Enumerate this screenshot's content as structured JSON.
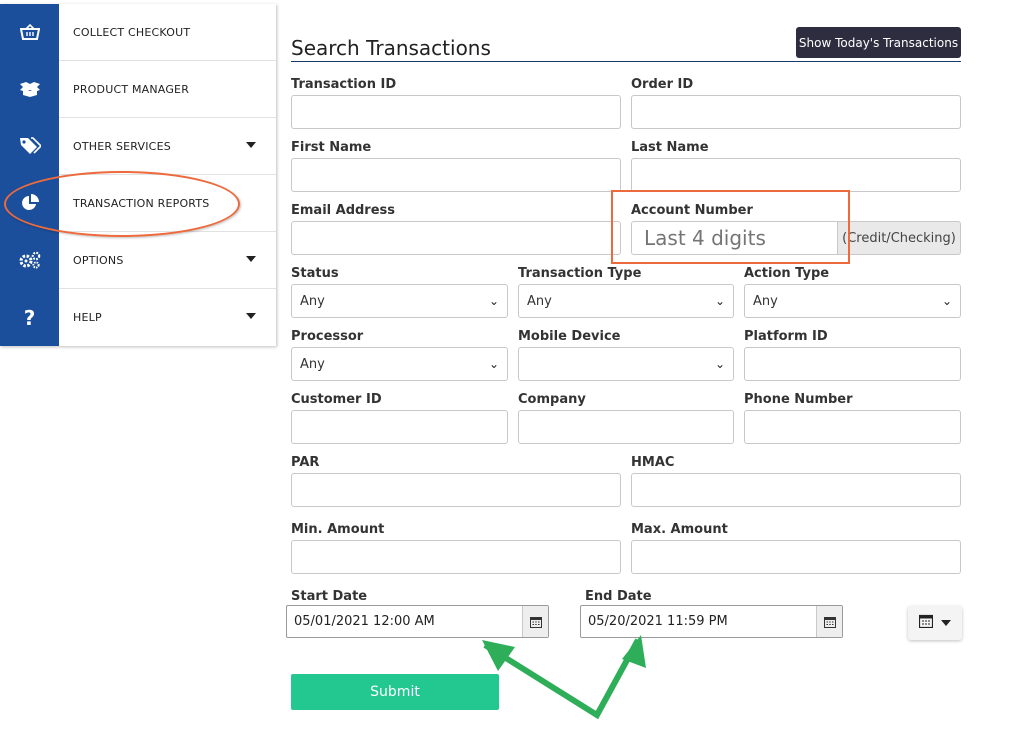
{
  "sidebar": {
    "items": [
      {
        "label": "COLLECT CHECKOUT",
        "icon": "basket-icon"
      },
      {
        "label": "PRODUCT MANAGER",
        "icon": "boxes-icon"
      },
      {
        "label": "OTHER SERVICES",
        "icon": "tags-icon"
      },
      {
        "label": "TRANSACTION REPORTS",
        "icon": "pie-chart-icon"
      },
      {
        "label": "OPTIONS",
        "icon": "gears-icon"
      },
      {
        "label": "HELP",
        "icon": "question-icon"
      }
    ]
  },
  "header": {
    "title": "Search Transactions",
    "today_button": "Show Today's Transactions"
  },
  "form": {
    "transaction_id": {
      "label": "Transaction ID",
      "value": ""
    },
    "order_id": {
      "label": "Order ID",
      "value": ""
    },
    "first_name": {
      "label": "First Name",
      "value": ""
    },
    "last_name": {
      "label": "Last Name",
      "value": ""
    },
    "email": {
      "label": "Email Address",
      "value": ""
    },
    "account_number": {
      "label": "Account Number",
      "placeholder": "Last 4 digits",
      "addon": "(Credit/Checking)"
    },
    "status": {
      "label": "Status",
      "selected": "Any"
    },
    "transaction_type": {
      "label": "Transaction Type",
      "selected": "Any"
    },
    "action_type": {
      "label": "Action Type",
      "selected": "Any"
    },
    "processor": {
      "label": "Processor",
      "selected": "Any"
    },
    "mobile_device": {
      "label": "Mobile Device",
      "selected": ""
    },
    "platform_id": {
      "label": "Platform ID",
      "value": ""
    },
    "customer_id": {
      "label": "Customer ID",
      "value": ""
    },
    "company": {
      "label": "Company",
      "value": ""
    },
    "phone_number": {
      "label": "Phone Number",
      "value": ""
    },
    "par": {
      "label": "PAR",
      "value": ""
    },
    "hmac": {
      "label": "HMAC",
      "value": ""
    },
    "min_amount": {
      "label": "Min. Amount",
      "value": ""
    },
    "max_amount": {
      "label": "Max. Amount",
      "value": ""
    },
    "start_date": {
      "label": "Start Date",
      "value": "05/01/2021 12:00 AM"
    },
    "end_date": {
      "label": "End Date",
      "value": "05/20/2021 11:59 PM"
    },
    "submit": "Submit"
  },
  "colors": {
    "nav_blue": "#1b4f9c",
    "submit_green": "#23c890",
    "highlight_orange": "#ec6a3b",
    "arrow_green": "#2fae5a"
  }
}
